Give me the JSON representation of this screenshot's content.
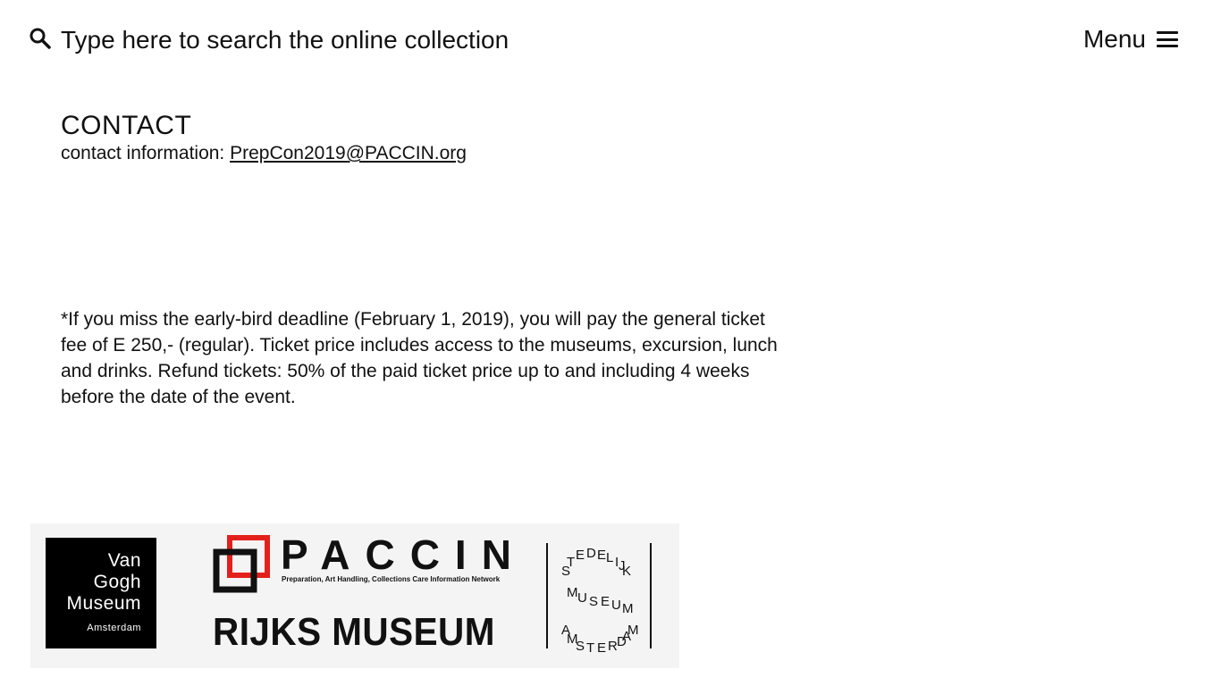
{
  "header": {
    "search_placeholder": "Type here to search the online collection",
    "menu_label": "Menu"
  },
  "contact": {
    "title": "CONTACT",
    "label": "contact information: ",
    "email": "PrepCon2019@PACCIN.org"
  },
  "footnote": "*If you miss the early-bird deadline (February 1, 2019), you will pay the general ticket fee of E 250,- (regular). Ticket price includes access to the museums, excursion, lunch and drinks. Refund tickets: 50% of the paid ticket price up to and including 4 weeks before the date of the event.",
  "logos": {
    "van_gogh": {
      "name": "Van\nGogh\nMuseum",
      "city": "Amsterdam"
    },
    "paccin": {
      "name": "PACCIN",
      "subtitle": "Preparation, Art Handling, Collections Care Information Network",
      "accent": "#e3201b"
    },
    "rijks": {
      "name": "RIJKS MUSEUM"
    },
    "stedelijk": {
      "word1": [
        "S",
        "T",
        "E",
        "D",
        "E",
        "L",
        "I",
        "J",
        "K"
      ],
      "word2": [
        "M",
        "U",
        "S",
        "E",
        "U",
        "M"
      ],
      "word3": [
        "A",
        "M",
        "S",
        "T",
        "E",
        "R",
        "D",
        "A",
        "M"
      ]
    }
  }
}
